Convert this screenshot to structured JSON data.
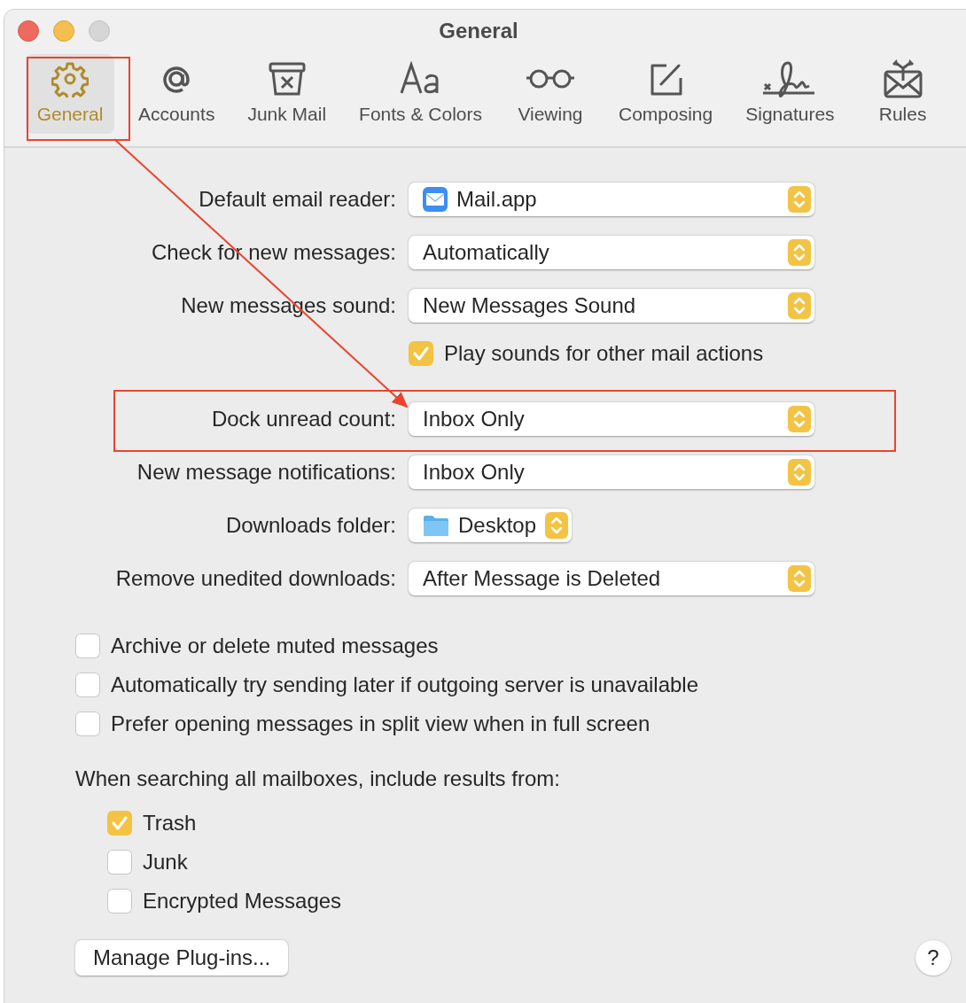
{
  "window": {
    "title": "General"
  },
  "tabs": [
    {
      "label": "General",
      "selected": true
    },
    {
      "label": "Accounts",
      "selected": false
    },
    {
      "label": "Junk Mail",
      "selected": false
    },
    {
      "label": "Fonts & Colors",
      "selected": false
    },
    {
      "label": "Viewing",
      "selected": false
    },
    {
      "label": "Composing",
      "selected": false
    },
    {
      "label": "Signatures",
      "selected": false
    },
    {
      "label": "Rules",
      "selected": false
    }
  ],
  "settings": [
    {
      "kind": "app-popup",
      "label": "Default email reader:",
      "value": "Mail.app"
    },
    {
      "kind": "popup",
      "label": "Check for new messages:",
      "value": "Automatically"
    },
    {
      "kind": "popup",
      "label": "New messages sound:",
      "value": "New Messages Sound"
    },
    {
      "kind": "checkbox",
      "label": "Play sounds for other mail actions",
      "checked": true
    },
    {
      "kind": "popup",
      "label": "Dock unread count:",
      "value": "Inbox Only"
    },
    {
      "kind": "popup",
      "label": "New message notifications:",
      "value": "Inbox Only"
    },
    {
      "kind": "folder-popup",
      "label": "Downloads folder:",
      "value": "Desktop"
    },
    {
      "kind": "popup",
      "label": "Remove unedited downloads:",
      "value": "After Message is Deleted"
    }
  ],
  "options": [
    {
      "label": "Archive or delete muted messages",
      "checked": false
    },
    {
      "label": "Automatically try sending later if outgoing server is unavailable",
      "checked": false
    },
    {
      "label": "Prefer opening messages in split view when in full screen",
      "checked": false
    }
  ],
  "search_sources": {
    "heading": "When searching all mailboxes, include results from:",
    "items": [
      {
        "label": "Trash",
        "checked": true
      },
      {
        "label": "Junk",
        "checked": false
      },
      {
        "label": "Encrypted Messages",
        "checked": false
      }
    ]
  },
  "buttons": [
    {
      "label": "Manage Plug-ins..."
    },
    {
      "label": "?"
    }
  ]
}
